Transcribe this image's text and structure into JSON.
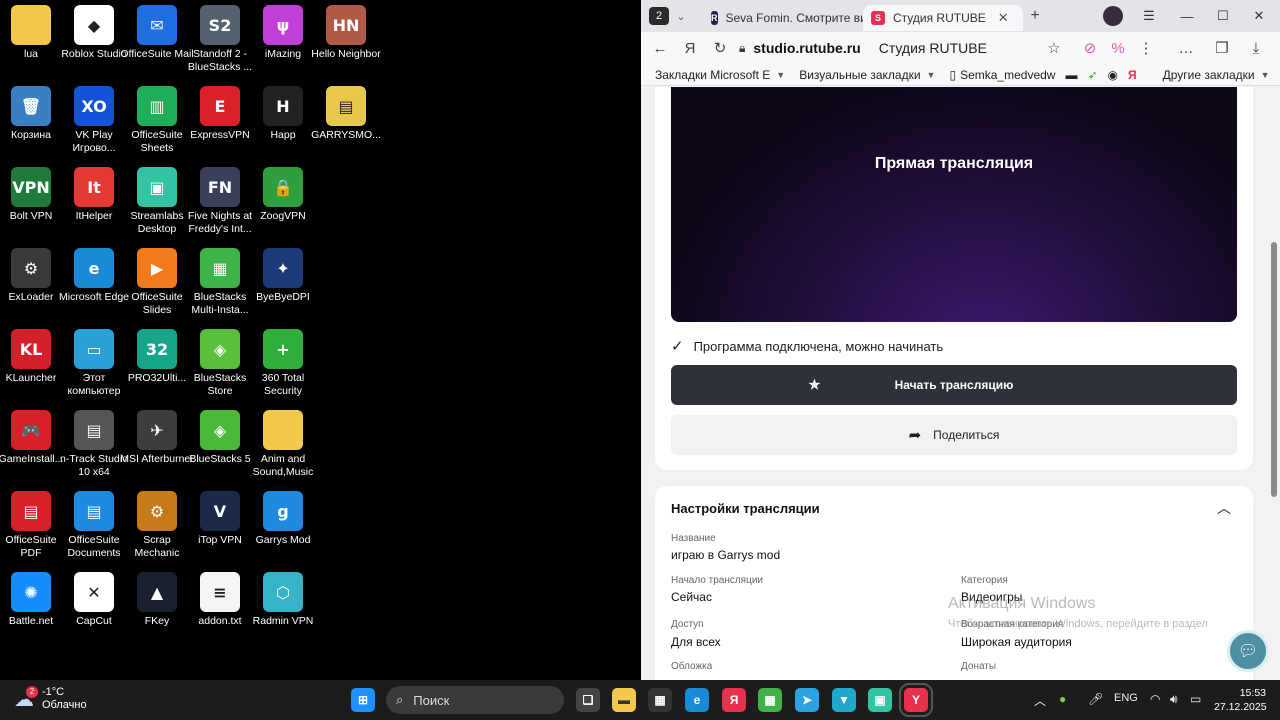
{
  "desktop": {
    "icons": [
      {
        "label": "lua",
        "icon": "folder-icon",
        "color": "#f2c94c",
        "glyph": "",
        "x": 0,
        "y": 0
      },
      {
        "label": "Roblox Studio",
        "icon": "roblox-studio-icon",
        "color": "#ffffff",
        "glyph": "◆",
        "x": 1,
        "y": 0
      },
      {
        "label": "OfficeSuite Mail",
        "icon": "officesuite-mail-icon",
        "color": "#1f6fe0",
        "glyph": "✉",
        "x": 2,
        "y": 0
      },
      {
        "label": "Standoff 2 - BlueStacks ...",
        "icon": "standoff-icon",
        "color": "#556070",
        "glyph": "S2",
        "x": 3,
        "y": 0
      },
      {
        "label": "iMazing",
        "icon": "imazing-icon",
        "color": "#c03fd6",
        "glyph": "ψ",
        "x": 4,
        "y": 0
      },
      {
        "label": "Hello Neighbor",
        "icon": "hello-neighbor-icon",
        "color": "#b05a48",
        "glyph": "HN",
        "x": 5,
        "y": 0
      },
      {
        "label": "Корзина",
        "icon": "recycle-bin-icon",
        "color": "#3a7fc4",
        "glyph": "🗑",
        "x": 0,
        "y": 1
      },
      {
        "label": "VK Play Игрово...",
        "icon": "vk-play-icon",
        "color": "#1353d6",
        "glyph": "XO",
        "x": 1,
        "y": 1
      },
      {
        "label": "OfficeSuite Sheets",
        "icon": "officesuite-sheets-icon",
        "color": "#1fae57",
        "glyph": "▥",
        "x": 2,
        "y": 1
      },
      {
        "label": "ExpressVPN",
        "icon": "expressvpn-icon",
        "color": "#da2128",
        "glyph": "E",
        "x": 3,
        "y": 1
      },
      {
        "label": "Happ",
        "icon": "happ-icon",
        "color": "#222222",
        "glyph": "H",
        "x": 4,
        "y": 1
      },
      {
        "label": "GARRYSMO...",
        "icon": "archive-icon",
        "color": "#e8c84a",
        "glyph": "▤",
        "x": 5,
        "y": 1
      },
      {
        "label": "Bolt VPN",
        "icon": "bolt-vpn-icon",
        "color": "#1f7a3c",
        "glyph": "VPN",
        "x": 0,
        "y": 2
      },
      {
        "label": "ItHelper",
        "icon": "ithelper-icon",
        "color": "#e53935",
        "glyph": "It",
        "x": 1,
        "y": 2
      },
      {
        "label": "Streamlabs Desktop",
        "icon": "streamlabs-icon",
        "color": "#31c3a2",
        "glyph": "▣",
        "x": 2,
        "y": 2
      },
      {
        "label": "Five Nights at Freddy's Int...",
        "icon": "fnaf-icon",
        "color": "#3a3f5a",
        "glyph": "FN",
        "x": 3,
        "y": 2
      },
      {
        "label": "ZoogVPN",
        "icon": "zoogvpn-icon",
        "color": "#2e9e3e",
        "glyph": "🔒",
        "x": 4,
        "y": 2
      },
      {
        "label": "ExLoader",
        "icon": "exloader-icon",
        "color": "#3a3a3a",
        "glyph": "⚙",
        "x": 0,
        "y": 3
      },
      {
        "label": "Microsoft Edge",
        "icon": "edge-icon",
        "color": "#1b8ad6",
        "glyph": "e",
        "x": 1,
        "y": 3
      },
      {
        "label": "OfficeSuite Slides",
        "icon": "officesuite-slides-icon",
        "color": "#f27a1a",
        "glyph": "▶",
        "x": 2,
        "y": 3
      },
      {
        "label": "BlueStacks Multi-Insta...",
        "icon": "bluestacks-multi-icon",
        "color": "#3fb24a",
        "glyph": "▦",
        "x": 3,
        "y": 3
      },
      {
        "label": "ByeByeDPI",
        "icon": "byebyedpi-icon",
        "color": "#1b3a7a",
        "glyph": "✦",
        "x": 4,
        "y": 3
      },
      {
        "label": "KLauncher",
        "icon": "klauncher-icon",
        "color": "#d41f2a",
        "glyph": "KL",
        "x": 0,
        "y": 4
      },
      {
        "label": "Этот компьютер",
        "icon": "this-pc-icon",
        "color": "#2a9fd8",
        "glyph": "▭",
        "x": 1,
        "y": 4
      },
      {
        "label": "PRO32Ulti...",
        "icon": "pro32-icon",
        "color": "#17a589",
        "glyph": "32",
        "x": 2,
        "y": 4
      },
      {
        "label": "BlueStacks Store",
        "icon": "bluestacks-store-icon",
        "color": "#5abf3a",
        "glyph": "◈",
        "x": 3,
        "y": 4
      },
      {
        "label": "360 Total Security",
        "icon": "360-security-icon",
        "color": "#2fae3a",
        "glyph": "+",
        "x": 4,
        "y": 4
      },
      {
        "label": "GameInstall...",
        "icon": "gameinstall-icon",
        "color": "#d81f2a",
        "glyph": "🎮",
        "x": 0,
        "y": 5
      },
      {
        "label": "n-Track Studio 10 x64",
        "icon": "ntrack-icon",
        "color": "#555555",
        "glyph": "▤",
        "x": 1,
        "y": 5
      },
      {
        "label": "MSI Afterburner",
        "icon": "msi-afterburner-icon",
        "color": "#3d3d3d",
        "glyph": "✈",
        "x": 2,
        "y": 5
      },
      {
        "label": "BlueStacks 5",
        "icon": "bluestacks5-icon",
        "color": "#4bb83a",
        "glyph": "◈",
        "x": 3,
        "y": 5
      },
      {
        "label": "Anim and Sound,Music",
        "icon": "folder-icon",
        "color": "#f2c94c",
        "glyph": "",
        "x": 4,
        "y": 5
      },
      {
        "label": "OfficeSuite PDF",
        "icon": "officesuite-pdf-icon",
        "color": "#d81f2a",
        "glyph": "▤",
        "x": 0,
        "y": 6
      },
      {
        "label": "OfficeSuite Documents",
        "icon": "officesuite-docs-icon",
        "color": "#1f8ae0",
        "glyph": "▤",
        "x": 1,
        "y": 6
      },
      {
        "label": "Scrap Mechanic",
        "icon": "scrap-mechanic-icon",
        "color": "#c77a1a",
        "glyph": "⚙",
        "x": 2,
        "y": 6
      },
      {
        "label": "iTop VPN",
        "icon": "itop-vpn-icon",
        "color": "#1b2a4a",
        "glyph": "V",
        "x": 3,
        "y": 6
      },
      {
        "label": "Garrys Mod",
        "icon": "garrys-mod-icon",
        "color": "#1f8ae0",
        "glyph": "g",
        "x": 4,
        "y": 6
      },
      {
        "label": "Battle.net",
        "icon": "battlenet-icon",
        "color": "#148eff",
        "glyph": "✺",
        "x": 0,
        "y": 7
      },
      {
        "label": "CapCut",
        "icon": "capcut-icon",
        "color": "#ffffff",
        "glyph": "✕",
        "x": 1,
        "y": 7
      },
      {
        "label": "FKey",
        "icon": "fkey-icon",
        "color": "#1a2030",
        "glyph": "▲",
        "x": 2,
        "y": 7
      },
      {
        "label": "addon.txt",
        "icon": "text-file-icon",
        "color": "#f5f5f5",
        "glyph": "≡",
        "x": 3,
        "y": 7
      },
      {
        "label": "Radmin VPN",
        "icon": "radmin-vpn-icon",
        "color": "#35b3c9",
        "glyph": "⬡",
        "x": 4,
        "y": 7
      }
    ]
  },
  "browser": {
    "tab_counter": "2",
    "tabs": [
      {
        "label": "Seva Fomin. Смотрите ви",
        "icon": "rutube-r-icon",
        "color": "#2a1b4a"
      },
      {
        "label": "Студия RUTUBE",
        "icon": "rutube-studio-icon",
        "color": "#e8314c"
      }
    ],
    "url": "studio.rutube.ru",
    "page_title": "Студия RUTUBE",
    "bookmarks": [
      {
        "label": "Закладки Microsoft E"
      },
      {
        "label": "Визуальные закладки"
      },
      {
        "label": "Semka_medvedw"
      },
      {
        "label": "Другие закладки"
      }
    ]
  },
  "studio": {
    "preview_title": "Прямая трансляция",
    "status_text": "Программа подключена, можно начинать",
    "start_button": "Начать трансляцию",
    "share_button": "Поделиться",
    "settings_title": "Настройки трансляции",
    "fields": {
      "name_label": "Название",
      "name_value": "играю в Garrys mod",
      "start_label": "Начало трансляции",
      "start_value": "Сейчас",
      "category_label": "Категория",
      "category_value": "Видеоигры",
      "access_label": "Доступ",
      "access_value": "Для всех",
      "age_label": "Возрастная категория",
      "age_value": "Широкая аудитория",
      "cover_label": "Обложка",
      "donations_label": "Донаты"
    },
    "watermark_title": "Активация Windows",
    "watermark_text": "Чтобы активировать Windows, перейдите в раздел"
  },
  "taskbar": {
    "weather_temp": "-1°C",
    "weather_desc": "Облачно",
    "weather_badge": "2",
    "search_placeholder": "Поиск",
    "lang": "ENG",
    "time": "15:53",
    "date": "27.12.2025"
  }
}
